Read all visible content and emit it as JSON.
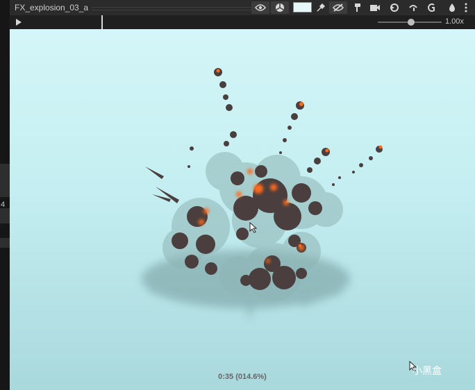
{
  "window": {
    "title": "FX_explosion_03_a"
  },
  "toolbar": {
    "icons": [
      "eye-icon",
      "cube-icon",
      "color-swatch",
      "eyedropper-icon",
      "eye-slash-icon",
      "paint-icon",
      "camera-icon",
      "sync-icon",
      "undo-icon",
      "g-icon",
      "flame-icon",
      "more-icon"
    ],
    "preview_color": "#e6f7fa"
  },
  "timeline": {
    "speed_label": "1.00x",
    "speed_level": 0.5
  },
  "viewport": {
    "timecode": "0:35 (014.6%)",
    "background_color": "#c4eef1",
    "smoke_color": "#4a3e3e",
    "fire_color": "#ff6a1a"
  },
  "left_panel": {
    "visible_char": "4"
  },
  "watermark": {
    "text": "小黑盒"
  }
}
